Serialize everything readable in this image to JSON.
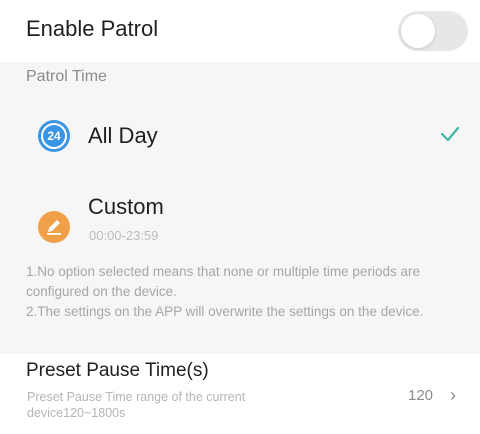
{
  "enable_patrol": {
    "label": "Enable Patrol",
    "toggle_on": false
  },
  "patrol_time": {
    "section_title": "Patrol Time",
    "options": [
      {
        "label": "All Day",
        "icon": "clock-24-icon",
        "icon_text": "24",
        "selected": true
      },
      {
        "label": "Custom",
        "icon": "pencil-icon",
        "subtitle": "00:00-23:59",
        "selected": false
      }
    ],
    "notes": [
      "1.No option selected means that none or multiple time periods are configured on the device.",
      "2.The settings on the APP will overwrite the settings on the device."
    ]
  },
  "preset_pause": {
    "title": "Preset Pause Time(s)",
    "description": "Preset Pause Time range of the current device120~1800s",
    "value": "120",
    "arrow": "›"
  },
  "colors": {
    "accent_blue": "#3a95e6",
    "accent_orange": "#f0a048",
    "check_teal": "#3fb8a6"
  }
}
